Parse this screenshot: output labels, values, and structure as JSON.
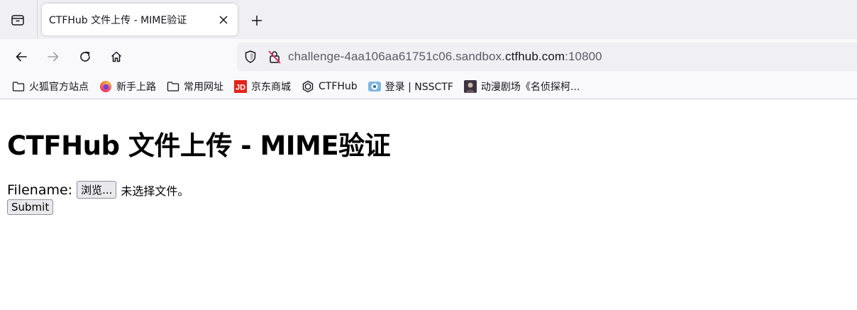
{
  "browser": {
    "tab": {
      "title": "CTFHub 文件上传 - MIME验证"
    },
    "url": {
      "prefix": "challenge-4aa106aa61751c06.sandbox.",
      "domain": "ctfhub.com",
      "suffix": ":10800"
    },
    "bookmarks": [
      {
        "label": "火狐官方站点",
        "icon": "folder-icon"
      },
      {
        "label": "新手上路",
        "icon": "firefox-icon"
      },
      {
        "label": "常用网址",
        "icon": "folder-icon"
      },
      {
        "label": "京东商城",
        "icon": "jd-icon"
      },
      {
        "label": "CTFHub",
        "icon": "ctfhub-icon"
      },
      {
        "label": "登录 | NSSCTF",
        "icon": "nssctf-icon"
      },
      {
        "label": "动漫剧场《名侦探柯...",
        "icon": "anime-icon"
      }
    ]
  },
  "page": {
    "title": "CTFHub 文件上传 - MIME验证",
    "form": {
      "filename_label": "Filename:",
      "browse_label": "浏览...",
      "no_file_text": "未选择文件。",
      "submit_label": "Submit"
    }
  },
  "colors": {
    "chrome_bg": "#f0f0f4",
    "toolbar_bg": "#f9f9fb",
    "jd_red": "#e1251b"
  }
}
